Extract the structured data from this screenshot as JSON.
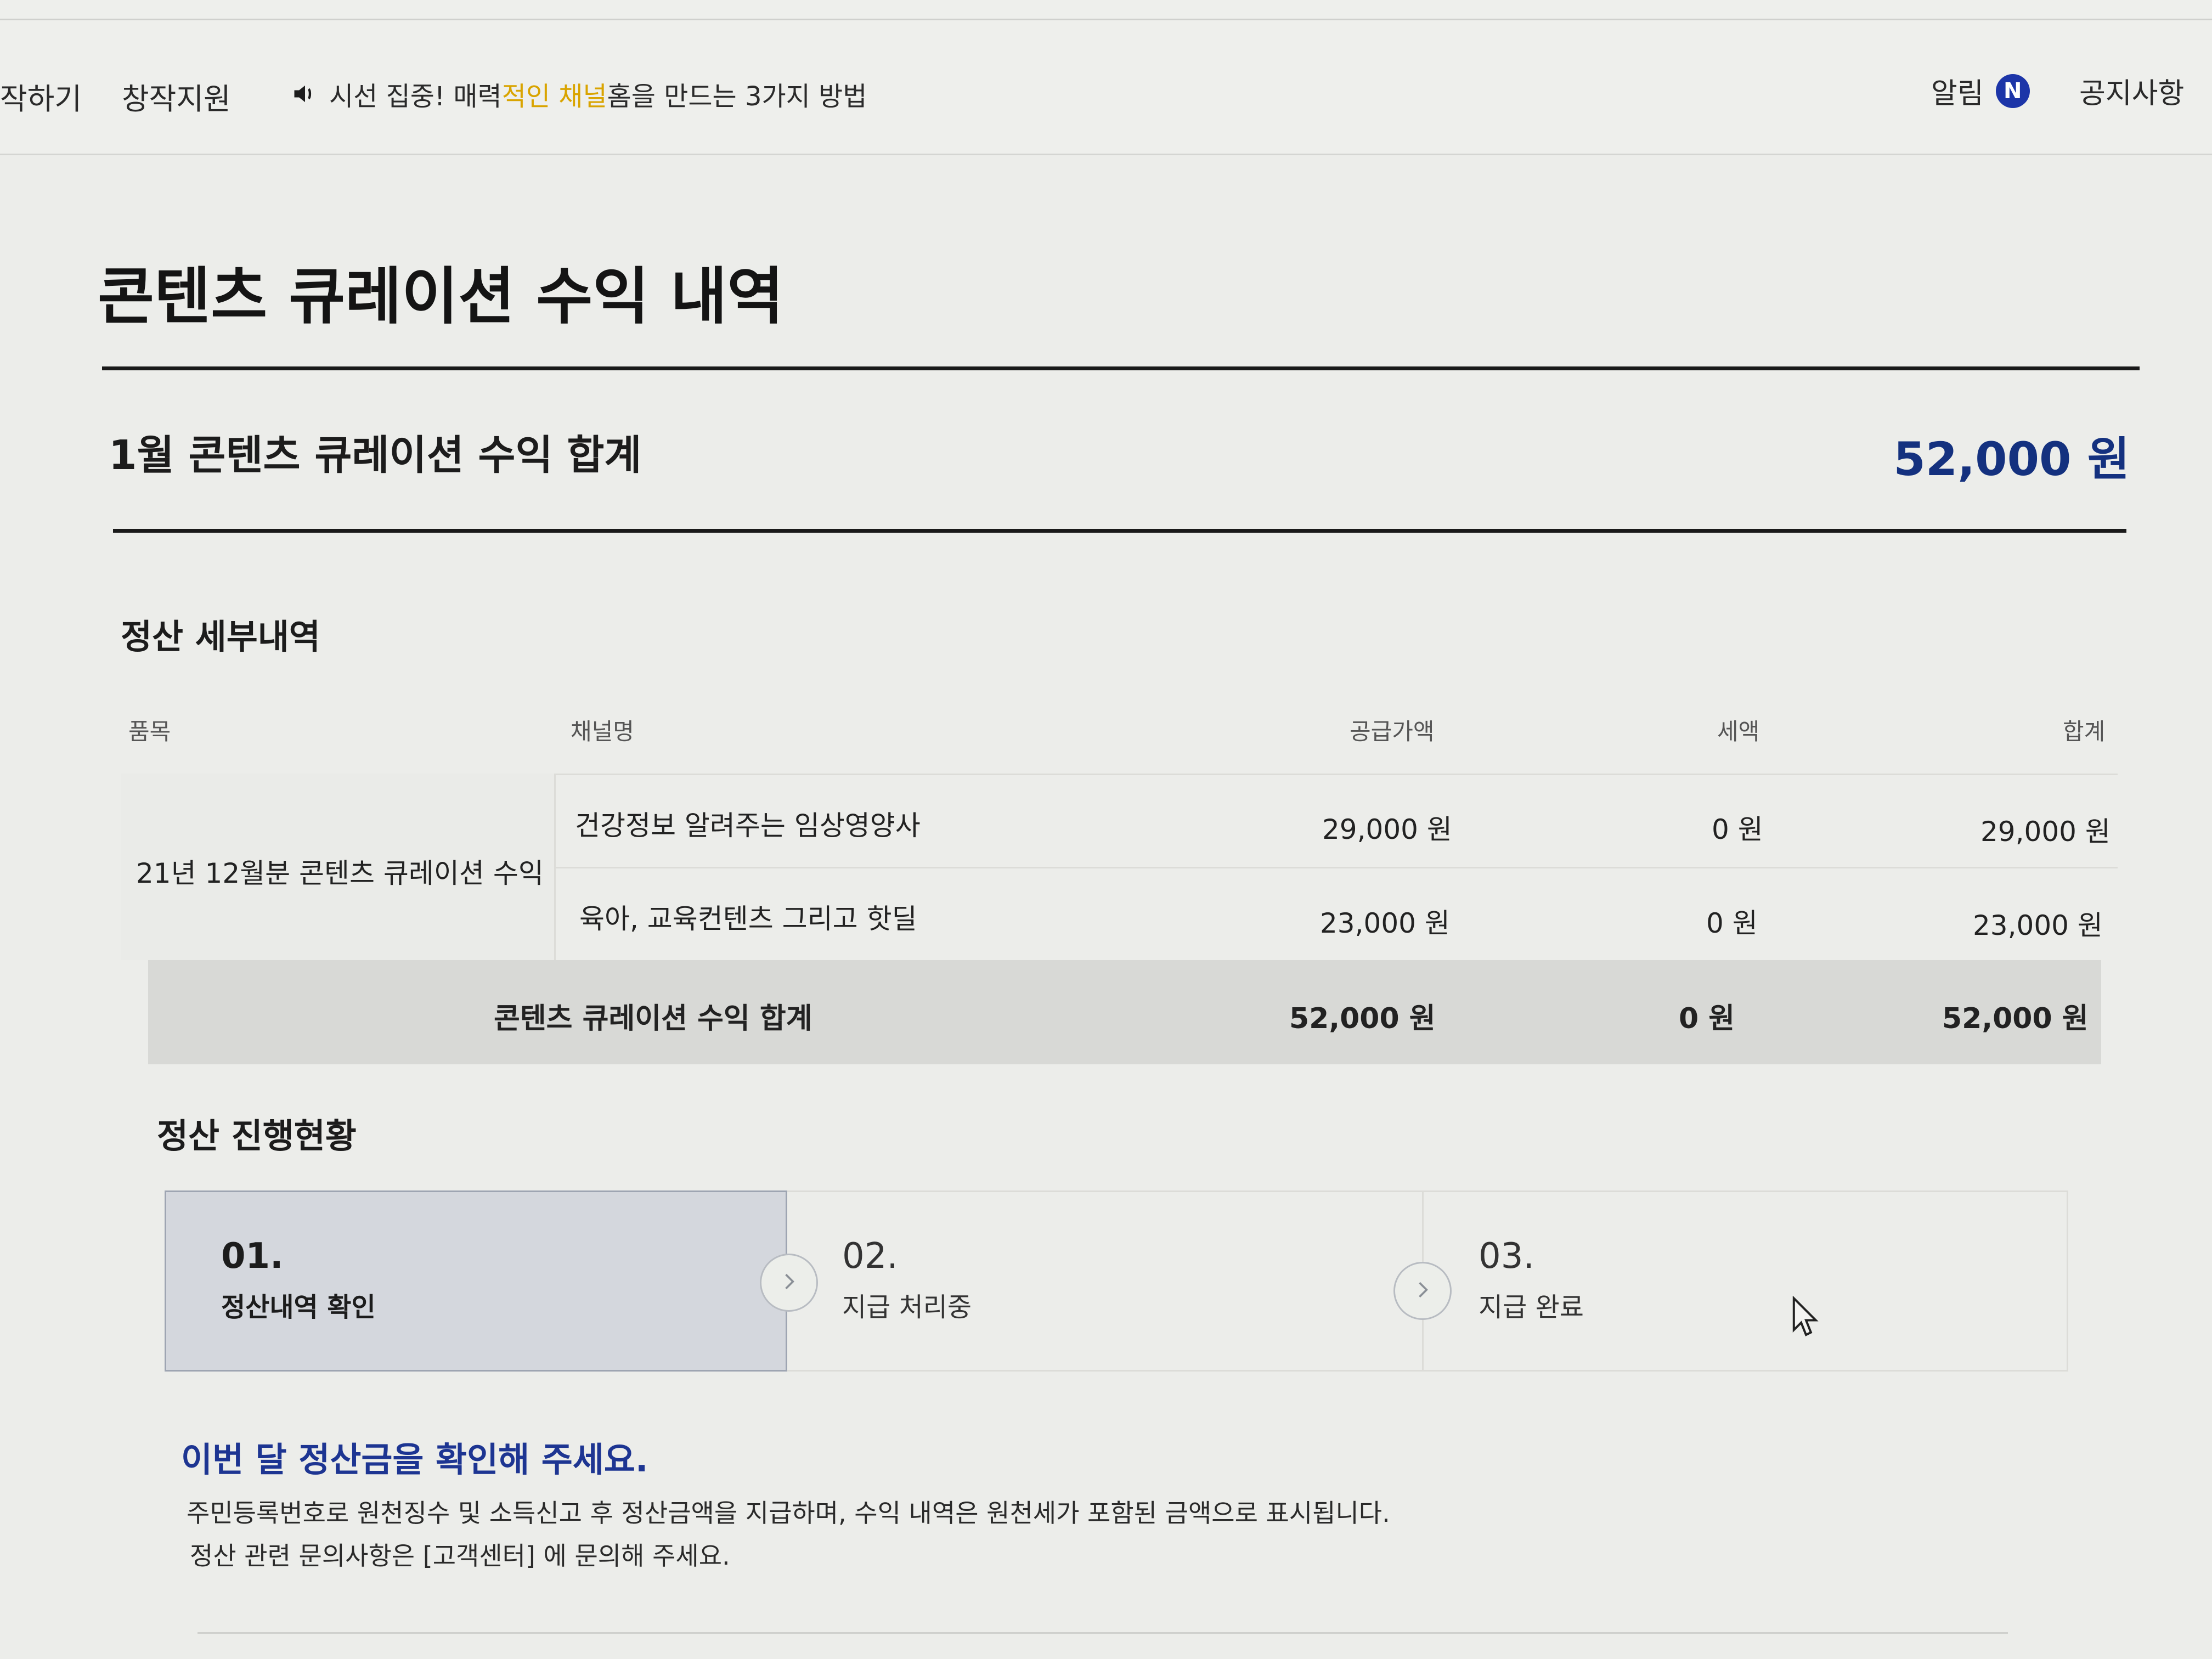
{
  "nav": {
    "item1": "작하기",
    "item2": "창작지원",
    "notice_pre": "시선 집중! 매력",
    "notice_hl": "적인 채널",
    "notice_post": " 홈을 만드는 3가지 방법",
    "alarm": "알림",
    "alarm_badge": "N",
    "notice_board": "공지사항"
  },
  "page": {
    "title": "콘텐츠 큐레이션 수익 내역",
    "month_total_label": "1월 콘텐츠 큐레이션 수익 합계",
    "month_total_value": "52,000 원"
  },
  "details": {
    "title": "정산 세부내역",
    "headers": {
      "item": "품목",
      "channel": "채널명",
      "supply": "공급가액",
      "tax": "세액",
      "sum": "합계"
    },
    "item_name": "21년 12월분 콘텐츠 큐레이션 수익",
    "rows": [
      {
        "channel": "건강정보 알려주는 임상영양사",
        "supply": "29,000 원",
        "tax": "0 원",
        "sum": "29,000 원"
      },
      {
        "channel": "육아, 교육컨텐츠 그리고 핫딜",
        "supply": "23,000 원",
        "tax": "0 원",
        "sum": "23,000 원"
      }
    ],
    "total": {
      "label": "콘텐츠 큐레이션 수익 합계",
      "supply": "52,000 원",
      "tax": "0 원",
      "sum": "52,000 원"
    }
  },
  "progress": {
    "title": "정산 진행현황",
    "steps": [
      {
        "num": "01.",
        "label": "정산내역 확인"
      },
      {
        "num": "02.",
        "label": "지급 처리중"
      },
      {
        "num": "03.",
        "label": "지급 완료"
      }
    ]
  },
  "info": {
    "title": "이번 달 정산금을 확인해 주세요.",
    "line1": "주민등록번호로 원천징수 및 소득신고 후 정산금액을 지급하며, 수익 내역은 원천세가 포함된 금액으로 표시됩니다.",
    "line2": "정산 관련 문의사항은 [고객센터] 에 문의해 주세요."
  },
  "colors": {
    "accent_blue": "#14317f",
    "badge_blue": "#1c35a8",
    "highlight_yellow": "#d9a400"
  }
}
